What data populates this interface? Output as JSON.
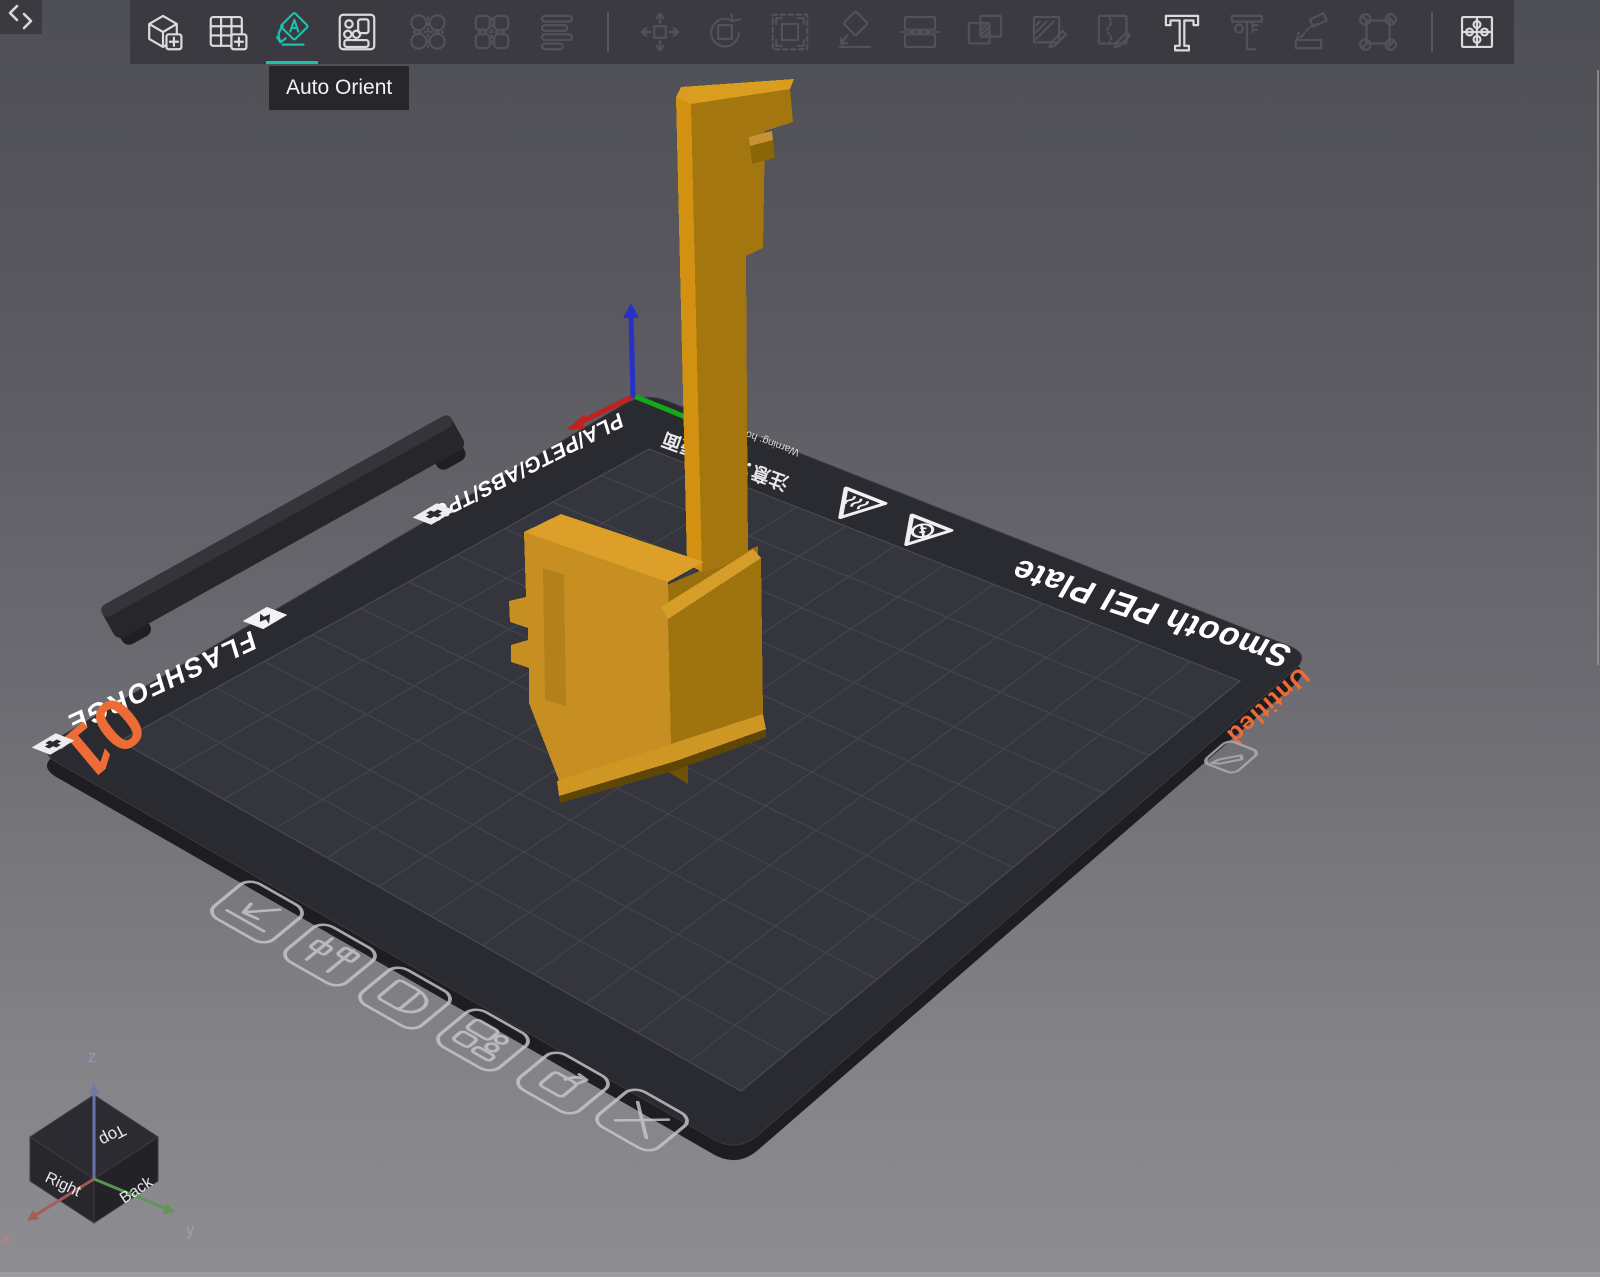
{
  "toolbar": {
    "tooltip": "Auto Orient",
    "items": [
      {
        "name": "add-model",
        "state": "enabled"
      },
      {
        "name": "add-plate",
        "state": "enabled"
      },
      {
        "name": "auto-orient",
        "state": "active"
      },
      {
        "name": "arrange",
        "state": "enabled"
      },
      {
        "name": "split-objects",
        "state": "disabled"
      },
      {
        "name": "split-parts",
        "state": "disabled"
      },
      {
        "name": "assembly-view",
        "state": "disabled"
      },
      {
        "name": "separator"
      },
      {
        "name": "move",
        "state": "disabled"
      },
      {
        "name": "rotate",
        "state": "disabled"
      },
      {
        "name": "scale",
        "state": "disabled"
      },
      {
        "name": "lay-flat",
        "state": "disabled"
      },
      {
        "name": "cut",
        "state": "disabled"
      },
      {
        "name": "mesh-boolean",
        "state": "disabled"
      },
      {
        "name": "paint",
        "state": "disabled"
      },
      {
        "name": "seam",
        "state": "disabled"
      },
      {
        "name": "text",
        "state": "enabled"
      },
      {
        "name": "measure",
        "state": "disabled"
      },
      {
        "name": "supports",
        "state": "disabled"
      },
      {
        "name": "fixture",
        "state": "disabled"
      },
      {
        "name": "separator"
      },
      {
        "name": "calibration",
        "state": "enabled"
      }
    ]
  },
  "plate": {
    "brand": "FLASHFORGE",
    "materials": "PLA/PETG/ABS/TPU",
    "surface": "Smooth PEI Plate",
    "name": "Untitled",
    "number": "01",
    "warning_cn": "注意：高温表面",
    "warning_en": "Warning: hot surface",
    "buttons": [
      "place-on-plate",
      "plate-settings",
      "plate-name",
      "arrange-plate",
      "orient-plate",
      "delete-plate"
    ]
  },
  "navcube": {
    "top": "Top",
    "right": "Right",
    "back": "Back",
    "x": "x",
    "y": "y",
    "z": "z"
  },
  "colors": {
    "accent": "#1CC0B0",
    "plate_name_orange": "#ED6C35",
    "model_orange": "#C78E22",
    "axis_x": "#C42020",
    "axis_y": "#16A816",
    "axis_z": "#2731C8"
  }
}
